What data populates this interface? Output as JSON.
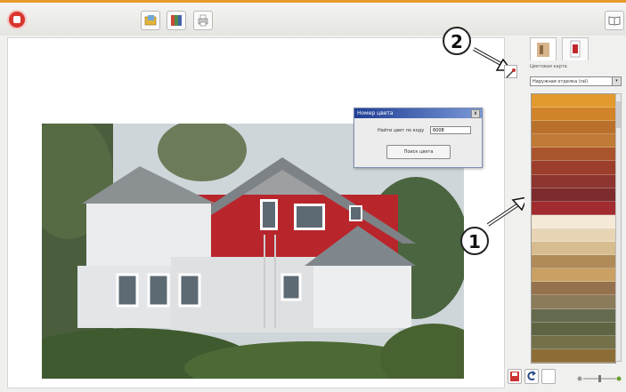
{
  "app": {
    "title": ""
  },
  "toolbar": {
    "buttons": [
      {
        "name": "open-photo",
        "icon": "folder-image-icon"
      },
      {
        "name": "palette",
        "icon": "palette-icon"
      },
      {
        "name": "print",
        "icon": "printer-icon"
      }
    ],
    "help_icon": "book-icon"
  },
  "dialog": {
    "title": "Номер цвета",
    "field_label": "Найти цвет по коду",
    "field_value": "6008",
    "button_label": "Поиск цвета",
    "close_label": "x"
  },
  "callouts": {
    "first": "1",
    "second": "2"
  },
  "panel": {
    "tabs": [
      {
        "icon": "facade-tab-icon",
        "active": true
      },
      {
        "icon": "interior-tab-icon",
        "active": false
      }
    ],
    "label": "Цветовая карта",
    "dropdown_value": "Наружная отделка (ral)",
    "colors": [
      "#e29a2e",
      "#d1832a",
      "#b9702a",
      "#c07a35",
      "#a9542d",
      "#9b3e2c",
      "#8e3530",
      "#7e2b2d",
      "#a12b2e",
      "#f3e9d6",
      "#e7d4b5",
      "#d6bc8e",
      "#b08a58",
      "#caa064",
      "#94724d",
      "#8c7b5a",
      "#646b4f",
      "#5f6443",
      "#73704a",
      "#8d6d36",
      "#b78a3c"
    ]
  },
  "bottom": {
    "buttons": [
      {
        "icon": "save-icon"
      },
      {
        "icon": "undo-icon"
      },
      {
        "icon": "blank-icon"
      }
    ],
    "zoom_label": "zoom-slider"
  }
}
